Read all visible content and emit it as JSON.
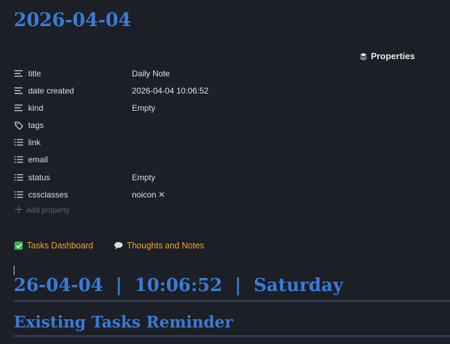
{
  "note": {
    "title": "2026-04-04"
  },
  "properties": {
    "heading": "Properties",
    "rows": [
      {
        "key": "title",
        "value": "Daily Note",
        "icon": "text-lines-icon"
      },
      {
        "key": "date created",
        "value": "2026-04-04 10:06:52",
        "icon": "text-lines-icon"
      },
      {
        "key": "kind",
        "value": "Empty",
        "icon": "text-lines-icon"
      },
      {
        "key": "tags",
        "value": "",
        "icon": "tag-icon"
      },
      {
        "key": "link",
        "value": "",
        "icon": "list-icon"
      },
      {
        "key": "email",
        "value": "",
        "icon": "list-icon"
      },
      {
        "key": "status",
        "value": "Empty",
        "icon": "list-icon"
      },
      {
        "key": "cssclasses",
        "value": "noicon",
        "icon": "list-icon"
      }
    ],
    "add_label": "Add property",
    "remove_symbol": "✕"
  },
  "links": {
    "tasks_dashboard": "Tasks Dashboard",
    "thoughts_notes": "Thoughts and Notes"
  },
  "content": {
    "heading1": "26-04-04  |  10:06:52  |  Saturday",
    "heading2": "Existing Tasks Reminder"
  },
  "colors": {
    "background": "#1c1f26",
    "heading": "#3b7ad6",
    "link": "#f0a535",
    "check": "#2fb550"
  }
}
